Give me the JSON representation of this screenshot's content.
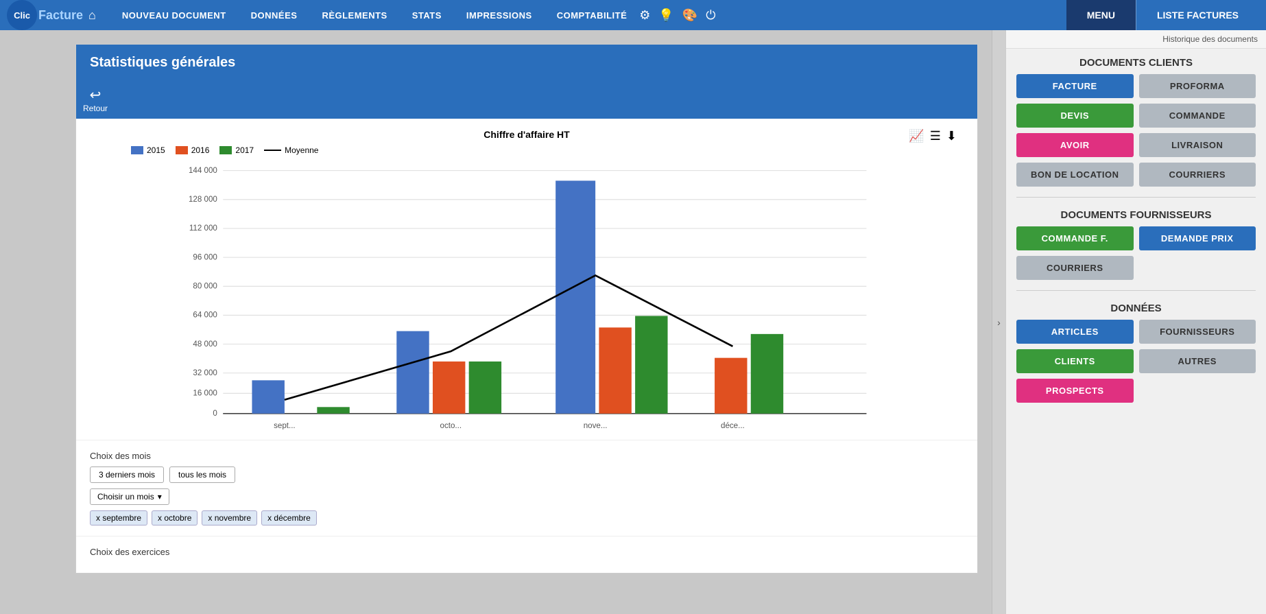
{
  "app": {
    "logo_clic": "Clic",
    "logo_facture": "Facture",
    "home_icon": "⌂"
  },
  "nav": {
    "items": [
      {
        "label": "NOUVEAU DOCUMENT"
      },
      {
        "label": "DONNÉES"
      },
      {
        "label": "RÈGLEMENTS"
      },
      {
        "label": "STATS"
      },
      {
        "label": "IMPRESSIONS"
      },
      {
        "label": "COMPTABILITÉ"
      }
    ],
    "icons": [
      "⚙",
      "💡",
      "🎨",
      "⏻"
    ],
    "menu_label": "MENU",
    "liste_label": "LISTE FACTURES"
  },
  "page": {
    "title": "Statistiques générales",
    "retour_label": "Retour",
    "breadcrumb": "Historique des documents"
  },
  "chart": {
    "title": "Chiffre d'affaire HT",
    "legend": [
      {
        "label": "2015",
        "color": "#4472C4"
      },
      {
        "label": "2016",
        "color": "#E05020"
      },
      {
        "label": "2017",
        "color": "#2E8B2E"
      },
      {
        "label": "Moyenne",
        "type": "line"
      }
    ],
    "y_labels": [
      "144 000",
      "128 000",
      "112 000",
      "96 000",
      "80 000",
      "64 000",
      "48 000",
      "32 000",
      "16 000",
      "0"
    ],
    "x_labels": [
      "sept...",
      "octo...",
      "nove...",
      "déce..."
    ],
    "bars": [
      {
        "month": "sept",
        "y2015": 20000,
        "y2016": 0,
        "y2017": 4000
      },
      {
        "month": "octo",
        "y2015": 49000,
        "y2016": 31000,
        "y2017": 31000
      },
      {
        "month": "nove",
        "y2015": 138000,
        "y2016": 51000,
        "y2017": 58000
      },
      {
        "month": "dece",
        "y2015": 0,
        "y2016": 33000,
        "y2017": 47000
      }
    ],
    "moyenne_points": [
      {
        "month": "sept",
        "val": 8000
      },
      {
        "month": "octo",
        "val": 37000
      },
      {
        "month": "nove",
        "val": 82000
      },
      {
        "month": "dece",
        "val": 40000
      }
    ]
  },
  "month_choices": {
    "label": "Choix des mois",
    "btn1": "3 derniers mois",
    "btn2": "tous les mois",
    "dropdown_label": "Choisir un mois",
    "tags": [
      {
        "label": "x septembre"
      },
      {
        "label": "x octobre"
      },
      {
        "label": "x novembre"
      },
      {
        "label": "x décembre"
      }
    ]
  },
  "exercises": {
    "label": "Choix des exercices"
  },
  "sidebar": {
    "breadcrumb": "Historique des documents",
    "docs_clients_title": "DOCUMENTS CLIENTS",
    "docs_fournisseurs_title": "DOCUMENTS FOURNISSEURS",
    "donnees_title": "DONNÉES",
    "clients_buttons": [
      {
        "label": "FACTURE",
        "style": "btn-blue"
      },
      {
        "label": "PROFORMA",
        "style": "btn-gray"
      },
      {
        "label": "DEVIS",
        "style": "btn-green"
      },
      {
        "label": "COMMANDE",
        "style": "btn-gray"
      },
      {
        "label": "AVOIR",
        "style": "btn-pink"
      },
      {
        "label": "LIVRAISON",
        "style": "btn-gray"
      },
      {
        "label": "BON DE LOCATION",
        "style": "btn-gray"
      },
      {
        "label": "COURRIERS",
        "style": "btn-gray"
      }
    ],
    "fournisseurs_buttons": [
      {
        "label": "COMMANDE F.",
        "style": "btn-green"
      },
      {
        "label": "DEMANDE PRIX",
        "style": "btn-blue"
      },
      {
        "label": "COURRIERS",
        "style": "btn-gray"
      }
    ],
    "donnees_buttons": [
      {
        "label": "ARTICLES",
        "style": "btn-blue"
      },
      {
        "label": "FOURNISSEURS",
        "style": "btn-gray"
      },
      {
        "label": "CLIENTS",
        "style": "btn-green"
      },
      {
        "label": "AUTRES",
        "style": "btn-gray"
      },
      {
        "label": "PROSPECTS",
        "style": "btn-pink"
      }
    ]
  }
}
